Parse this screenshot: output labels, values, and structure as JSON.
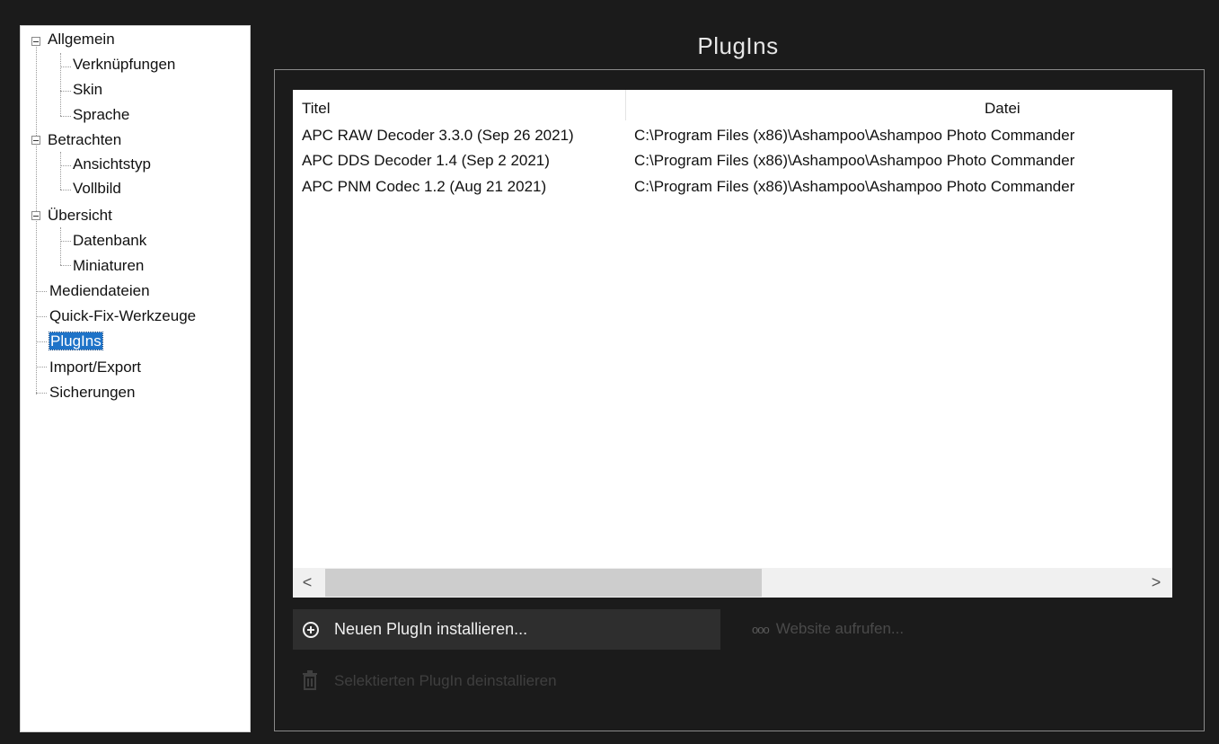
{
  "tree": {
    "items": [
      {
        "label": "Allgemein",
        "level": 0,
        "expandable": true
      },
      {
        "label": "Verknüpfungen",
        "level": 1
      },
      {
        "label": "Skin",
        "level": 1
      },
      {
        "label": "Sprache",
        "level": 1
      },
      {
        "label": "Betrachten",
        "level": 0,
        "expandable": true
      },
      {
        "label": "Ansichtstyp",
        "level": 1
      },
      {
        "label": "Vollbild",
        "level": 1
      },
      {
        "label": "Übersicht",
        "level": 0,
        "expandable": true
      },
      {
        "label": "Datenbank",
        "level": 1
      },
      {
        "label": "Miniaturen",
        "level": 1
      },
      {
        "label": "Mediendateien",
        "level": 0
      },
      {
        "label": "Quick-Fix-Werkzeuge",
        "level": 0
      },
      {
        "label": "PlugIns",
        "level": 0,
        "selected": true
      },
      {
        "label": "Import/Export",
        "level": 0
      },
      {
        "label": "Sicherungen",
        "level": 0
      }
    ]
  },
  "main": {
    "title": "PlugIns",
    "table": {
      "columns": [
        "Titel",
        "Datei"
      ],
      "rows": [
        [
          "APC RAW Decoder 3.3.0 (Sep 26 2021)",
          "C:\\Program Files (x86)\\Ashampoo\\Ashampoo Photo Commander"
        ],
        [
          "APC DDS Decoder 1.4 (Sep  2 2021)",
          "C:\\Program Files (x86)\\Ashampoo\\Ashampoo Photo Commander"
        ],
        [
          "APC PNM Codec 1.2 (Aug 21 2021)",
          "C:\\Program Files (x86)\\Ashampoo\\Ashampoo Photo Commander"
        ]
      ]
    },
    "scroll": {
      "left_arrow": "<",
      "right_arrow": ">"
    },
    "install_button": "Neuen PlugIn installieren...",
    "website_link": "Website aufrufen...",
    "uninstall_button": "Selektierten PlugIn deinstallieren"
  },
  "colors": {
    "background": "#1b1b1b",
    "selection": "#1e73c8",
    "button": "#2e2e2e",
    "disabled_text": "#4a4a4a"
  },
  "icons": [
    "expander-minus-icon",
    "plus-circle-icon",
    "dots-icon",
    "trash-icon",
    "chevron-left-icon",
    "chevron-right-icon"
  ]
}
